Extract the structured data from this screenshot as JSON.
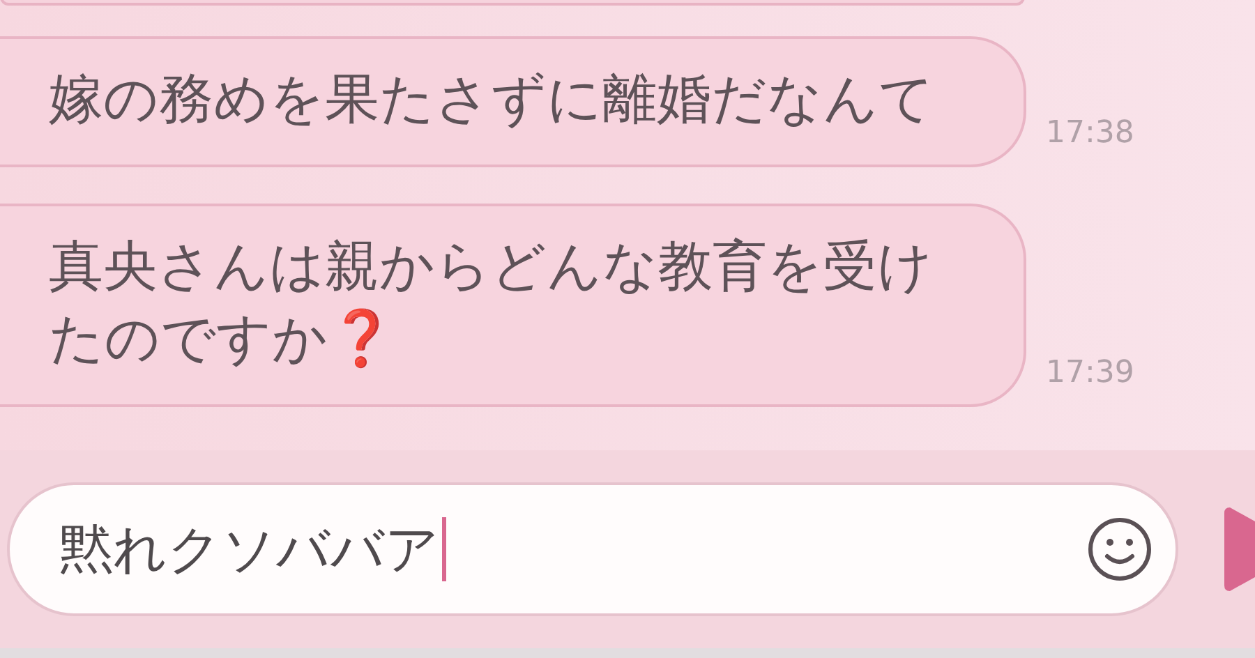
{
  "messages": [
    {
      "text": "嫁の務めを果たさずに離婚だなんて",
      "time": "17:38"
    },
    {
      "text": "真央さんは親からどんな教育を受けたのですか❓",
      "time": "17:39"
    }
  ],
  "composer": {
    "value": "黙れクソババア"
  }
}
